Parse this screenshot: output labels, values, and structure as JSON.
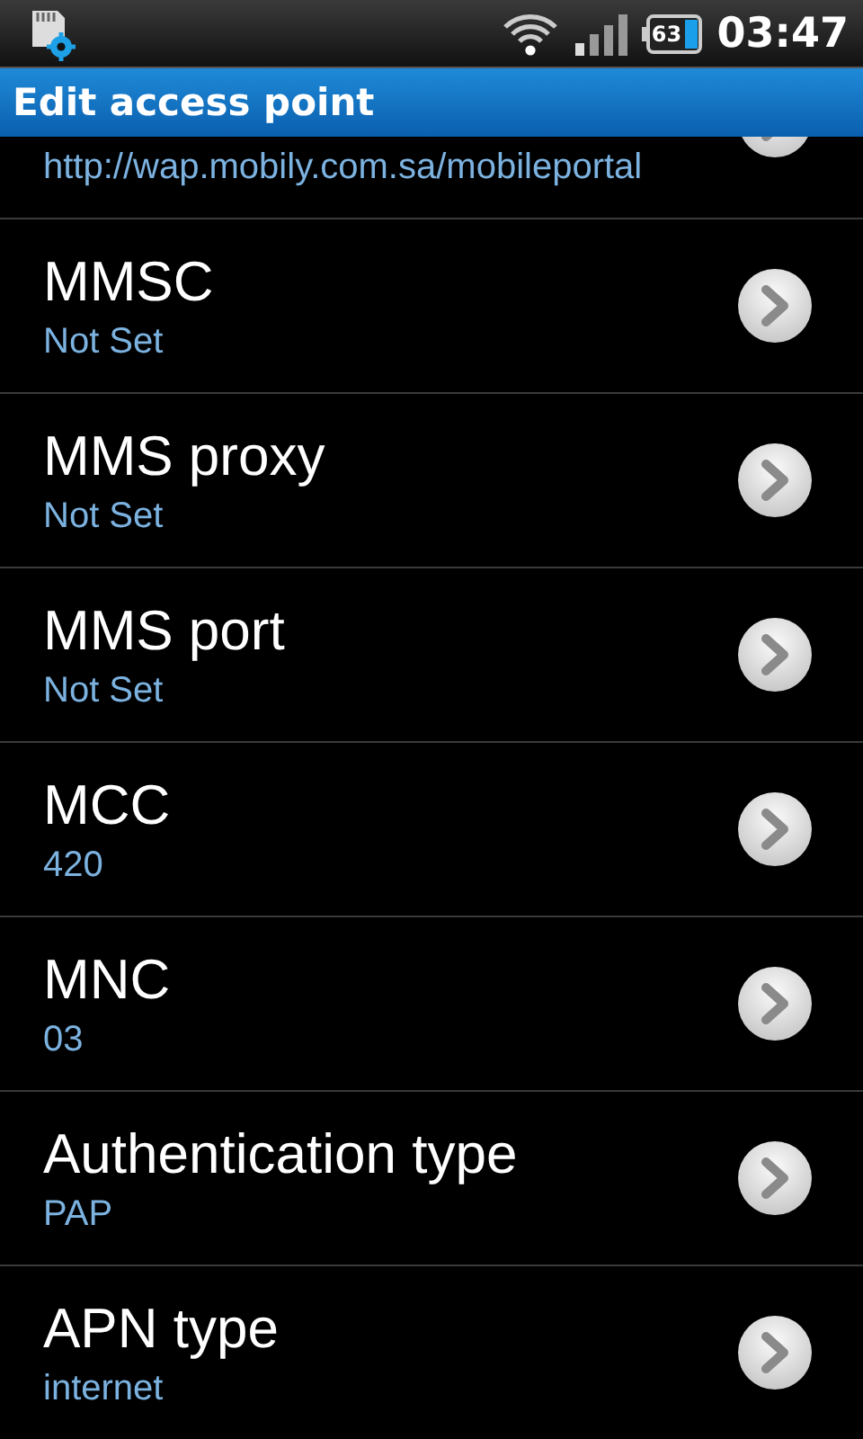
{
  "status_bar": {
    "battery": "63",
    "time": "03:47"
  },
  "title_bar": {
    "title": "Edit access point"
  },
  "items": [
    {
      "value": "http://wap.mobily.com.sa/mobileportal",
      "partial": true
    },
    {
      "title": "MMSC",
      "value": "Not Set",
      "partial": false
    },
    {
      "title": "MMS proxy",
      "value": "Not Set",
      "partial": false
    },
    {
      "title": "MMS port",
      "value": "Not Set",
      "partial": false
    },
    {
      "title": "MCC",
      "value": "420",
      "partial": false
    },
    {
      "title": "MNC",
      "value": "03",
      "partial": false
    },
    {
      "title": "Authentication type",
      "value": "PAP",
      "partial": false
    },
    {
      "title": "APN type",
      "value": "internet",
      "partial": false
    }
  ]
}
